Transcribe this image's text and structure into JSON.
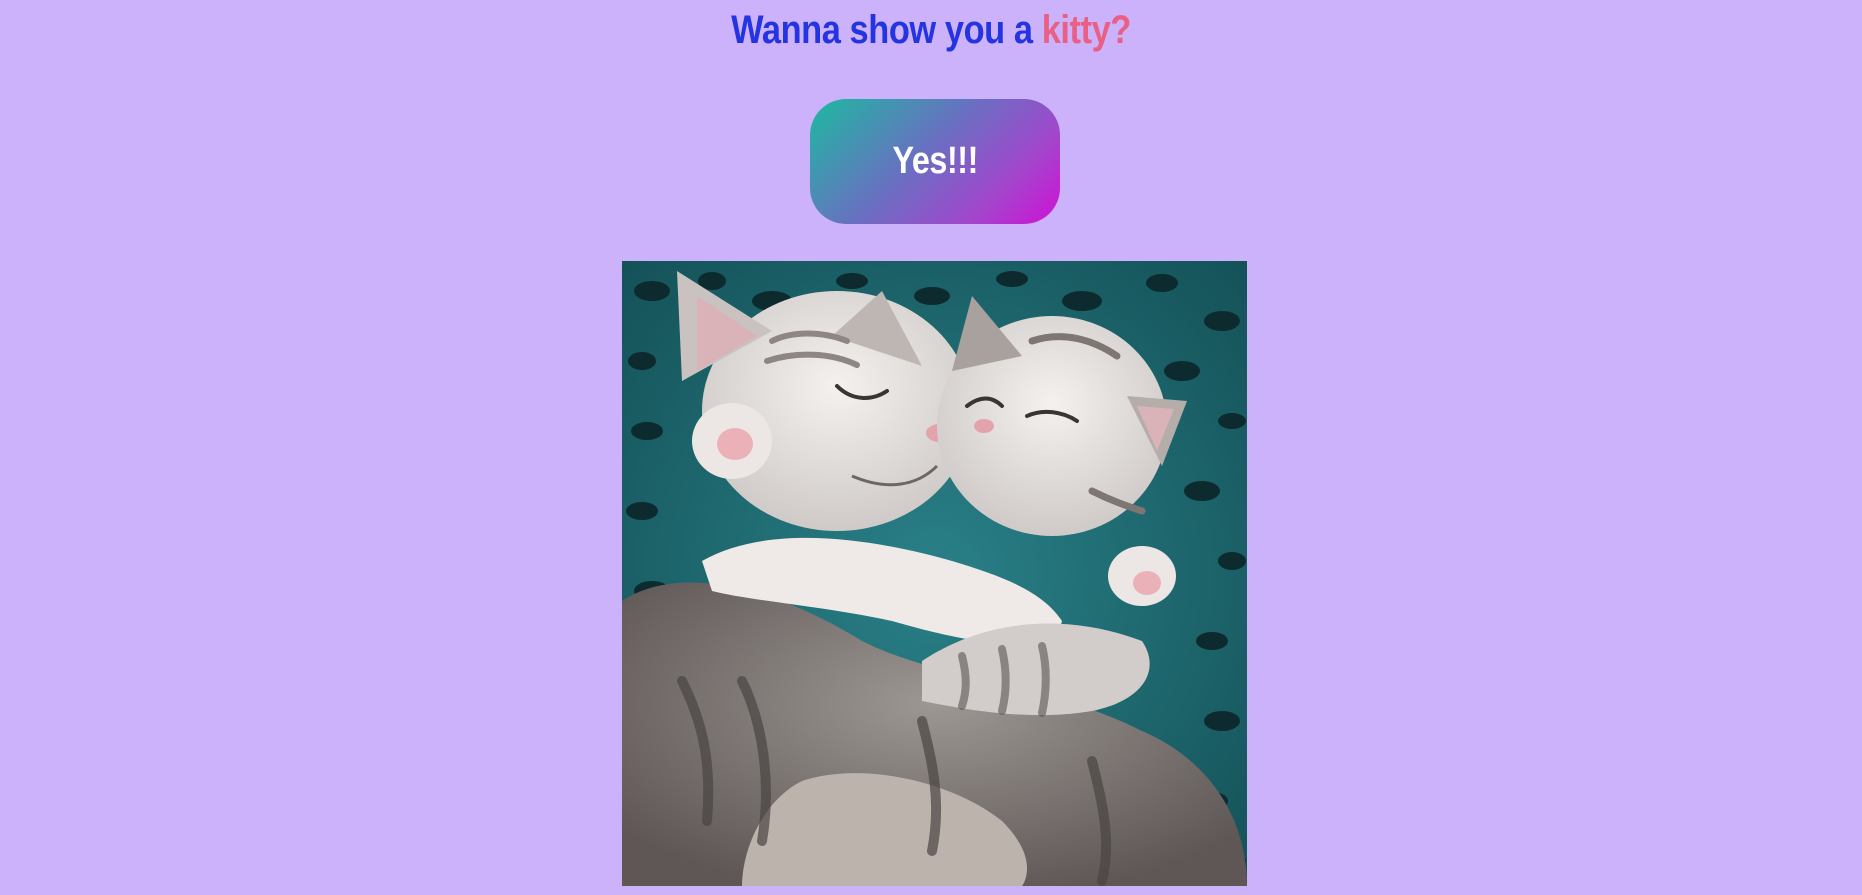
{
  "header": {
    "title_lead": "Wanna show you a ",
    "title_accent": "kitty?"
  },
  "cta": {
    "label": "Yes!!!"
  },
  "kitty": {
    "alt": "Two kittens hugging"
  },
  "colors": {
    "page_background": "#cbb2fa",
    "title_text": "#2434e0",
    "title_accent": "#ea5f86",
    "button_gradient_start": "#1cbaa0",
    "button_gradient_end": "#d010d6",
    "button_text": "#ffffff"
  }
}
